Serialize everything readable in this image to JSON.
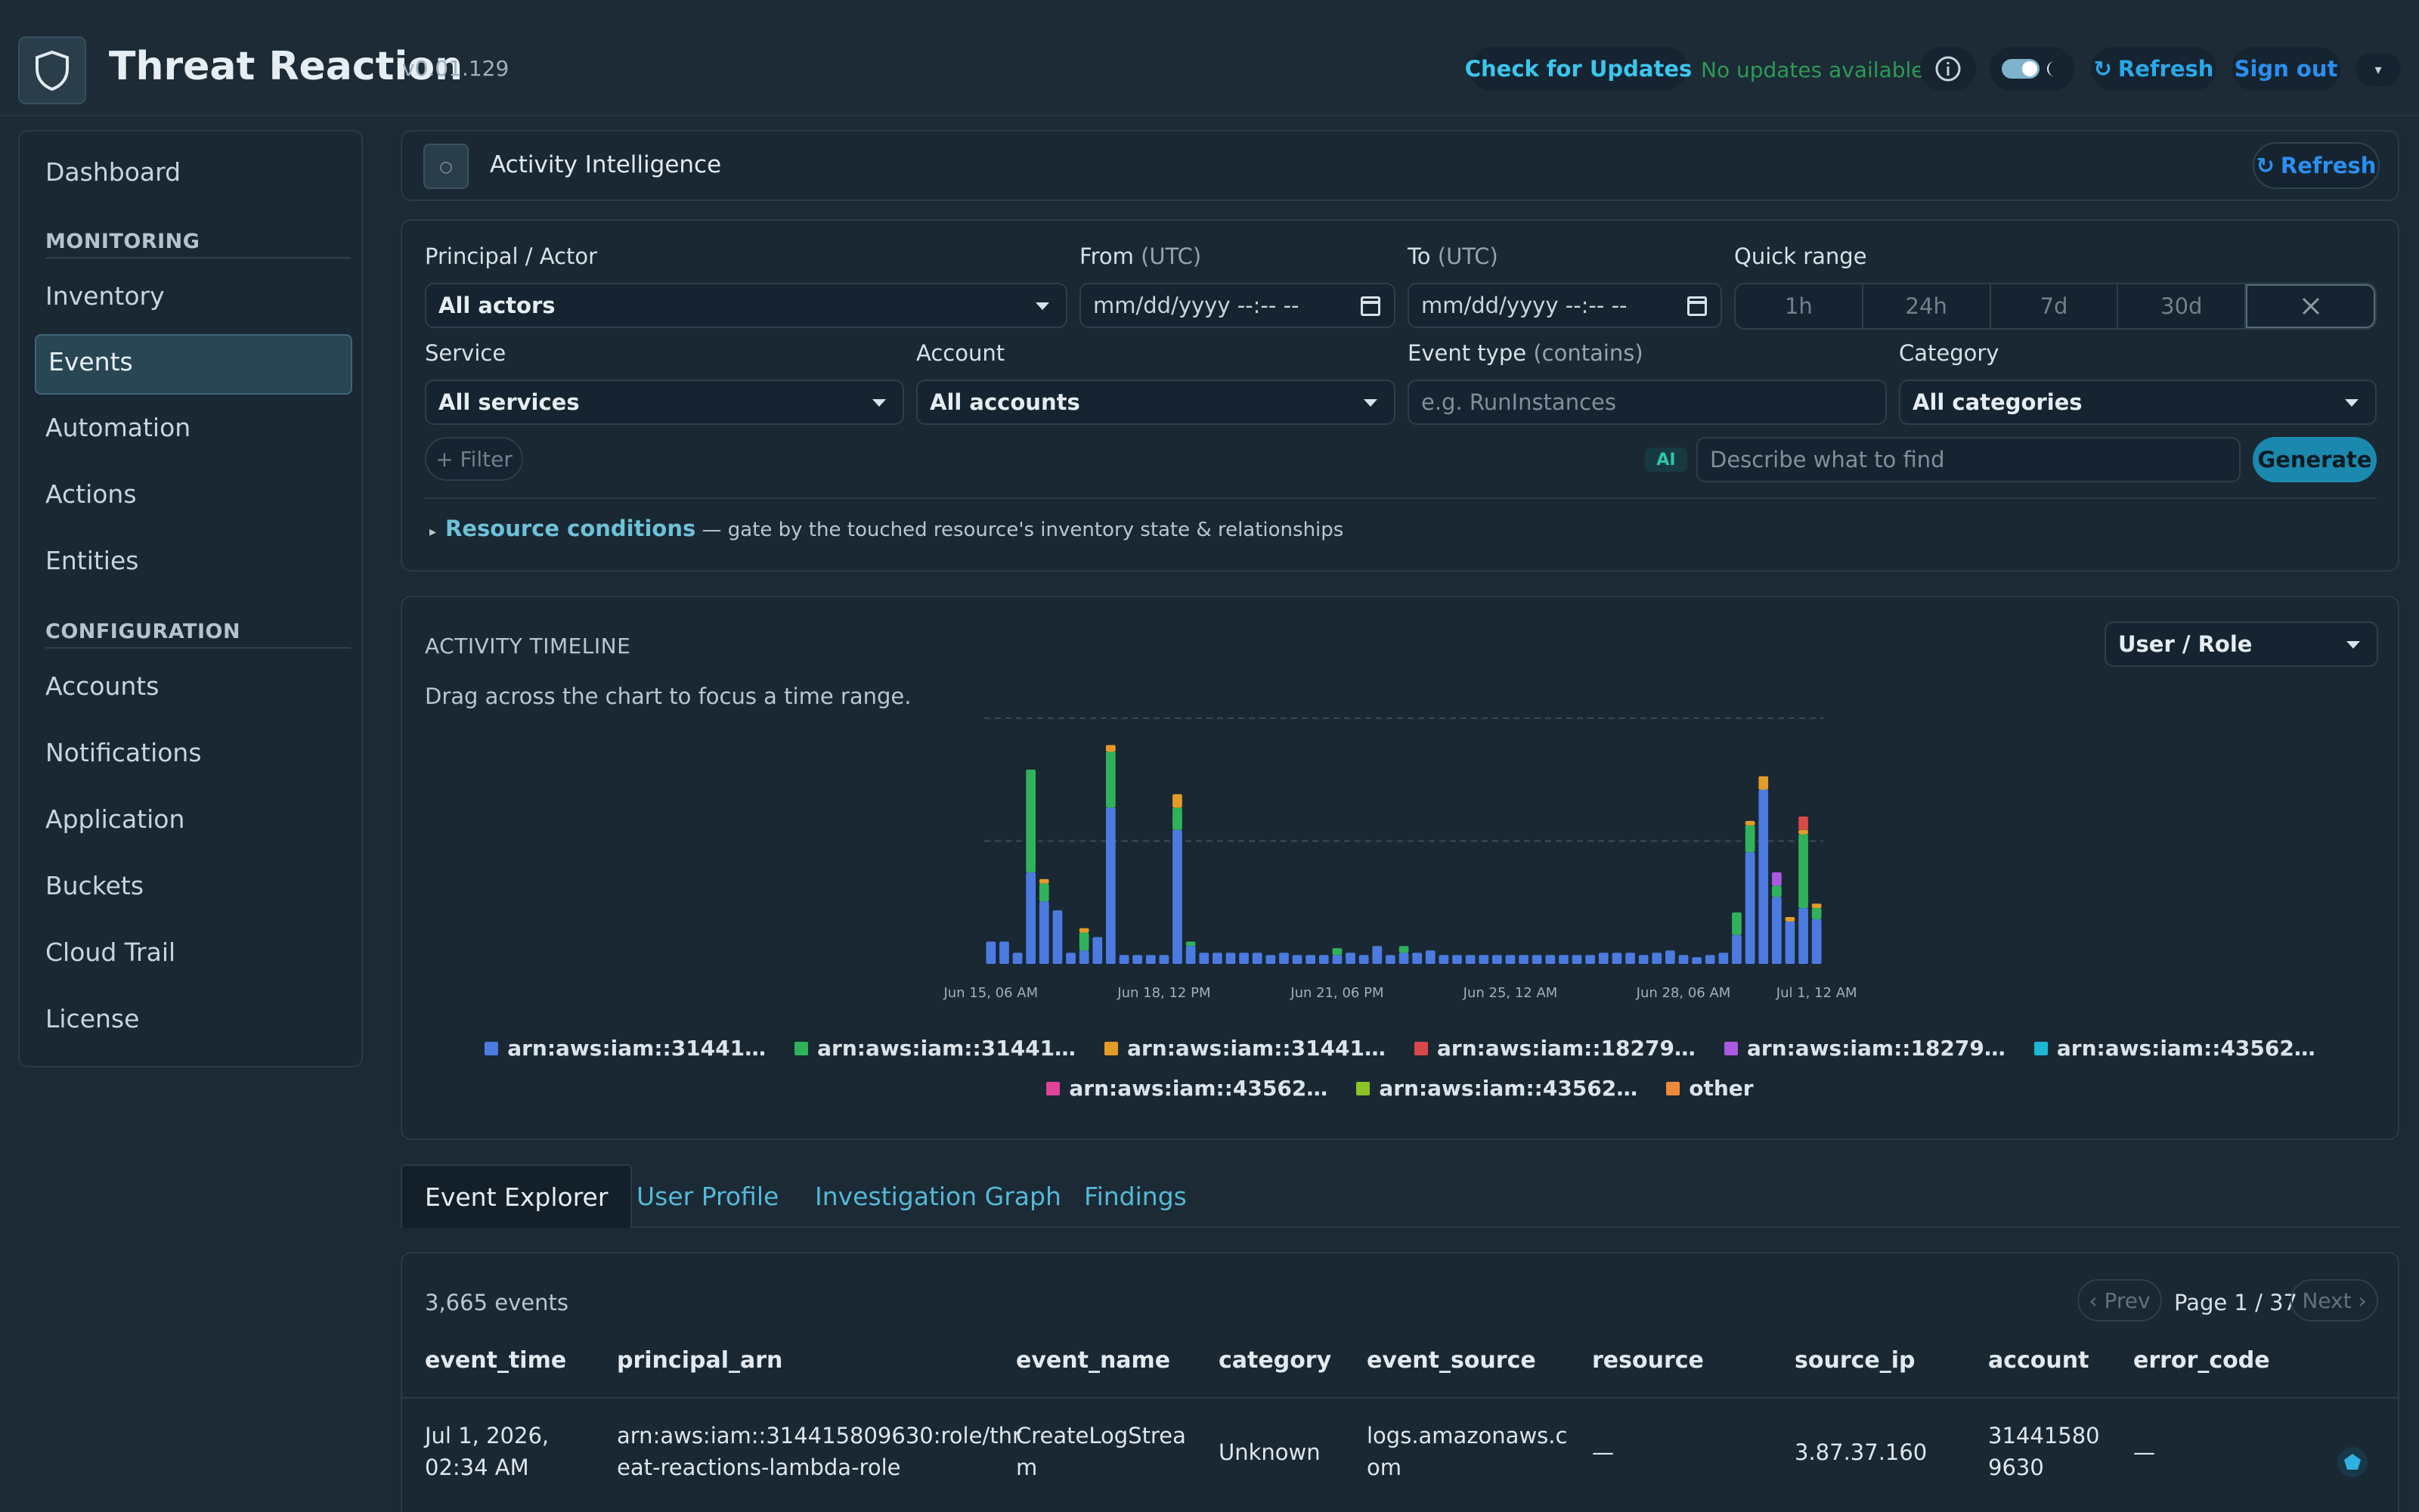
{
  "app": {
    "title": "Threat Reaction",
    "version": "v0.01.129",
    "check_updates": "Check for Updates",
    "update_status": "No updates available",
    "refresh": "Refresh",
    "sign_out": "Sign out"
  },
  "sidebar": {
    "items": [
      {
        "label": "Dashboard"
      },
      {
        "section": "MONITORING"
      },
      {
        "label": "Inventory"
      },
      {
        "label": "Events",
        "active": true
      },
      {
        "label": "Automation"
      },
      {
        "label": "Actions"
      },
      {
        "label": "Entities"
      },
      {
        "section": "CONFIGURATION"
      },
      {
        "label": "Accounts"
      },
      {
        "label": "Notifications"
      },
      {
        "label": "Application"
      },
      {
        "label": "Buckets"
      },
      {
        "label": "Cloud Trail"
      },
      {
        "label": "License"
      }
    ]
  },
  "activity": {
    "title": "Activity Intelligence",
    "refresh": "Refresh"
  },
  "filters": {
    "principal_label": "Principal / Actor",
    "principal_value": "All actors",
    "from_label": "From",
    "from_suffix": "(UTC)",
    "from_placeholder": "mm/dd/yyyy --:-- --",
    "to_label": "To",
    "to_suffix": "(UTC)",
    "to_placeholder": "mm/dd/yyyy --:-- --",
    "quick_range_label": "Quick range",
    "quick_ranges": [
      "1h",
      "24h",
      "7d",
      "30d"
    ],
    "service_label": "Service",
    "service_value": "All services",
    "account_label": "Account",
    "account_value": "All accounts",
    "event_type_label": "Event type",
    "event_type_suffix": "(contains)",
    "event_type_placeholder": "e.g. RunInstances",
    "category_label": "Category",
    "category_value": "All categories",
    "add_filter": "+ Filter",
    "ai_badge": "AI",
    "ai_placeholder": "Describe what to find",
    "generate": "Generate",
    "resource_conditions": "Resource conditions",
    "resource_conditions_desc": "— gate by the touched resource's inventory state & relationships"
  },
  "timeline": {
    "title": "ACTIVITY TIMELINE",
    "subtitle": "Drag across the chart to focus a time range.",
    "group_by": "User / Role"
  },
  "chart_data": {
    "type": "bar",
    "stacked": true,
    "x_tick_labels": [
      "Jun 15, 06 AM",
      "Jun 18, 12 PM",
      "Jun 21, 06 PM",
      "Jun 25, 12 AM",
      "Jun 28, 06 AM",
      "Jul 1, 12 AM"
    ],
    "x_tick_bar_index": [
      0,
      13,
      26,
      39,
      52,
      62
    ],
    "gridlines": [
      0.5,
      1.0
    ],
    "grid": "dashed horizontal",
    "legend_position": "bottom",
    "series": [
      {
        "name": "arn:aws:iam::31441…",
        "color": "#4b7be0",
        "values": [
          10,
          10,
          5,
          41,
          28,
          24,
          5,
          6,
          12,
          70,
          4,
          4,
          4,
          4,
          60,
          8,
          5,
          5,
          5,
          5,
          5,
          4,
          5,
          4,
          4,
          4,
          4,
          5,
          4,
          8,
          4,
          5,
          5,
          6,
          4,
          4,
          4,
          4,
          4,
          4,
          4,
          4,
          4,
          4,
          4,
          4,
          5,
          5,
          5,
          4,
          5,
          6,
          4,
          3,
          4,
          5,
          13,
          50,
          78,
          30,
          19,
          25,
          20
        ]
      },
      {
        "name": "arn:aws:iam::31441…",
        "color": "#2fb25b",
        "values": [
          0,
          0,
          0,
          46,
          8,
          0,
          0,
          8,
          0,
          25,
          0,
          0,
          0,
          0,
          10,
          2,
          0,
          0,
          0,
          0,
          0,
          0,
          0,
          0,
          0,
          0,
          3,
          0,
          0,
          0,
          0,
          3,
          0,
          0,
          0,
          0,
          0,
          0,
          0,
          0,
          0,
          0,
          0,
          0,
          0,
          0,
          0,
          0,
          0,
          0,
          0,
          0,
          0,
          0,
          0,
          0,
          10,
          12,
          0,
          5,
          0,
          33,
          5
        ]
      },
      {
        "name": "arn:aws:iam::31441…",
        "color": "#e39b28",
        "values": [
          0,
          0,
          0,
          0,
          2,
          0,
          0,
          2,
          0,
          3,
          0,
          0,
          0,
          0,
          6,
          0,
          0,
          0,
          0,
          0,
          0,
          0,
          0,
          0,
          0,
          0,
          0,
          0,
          0,
          0,
          0,
          0,
          0,
          0,
          0,
          0,
          0,
          0,
          0,
          0,
          0,
          0,
          0,
          0,
          0,
          0,
          0,
          0,
          0,
          0,
          0,
          0,
          0,
          0,
          0,
          0,
          0,
          2,
          6,
          0,
          2,
          2,
          2
        ]
      },
      {
        "name": "arn:aws:iam::18279…",
        "color": "#d94848",
        "values": [
          0,
          0,
          0,
          0,
          0,
          0,
          0,
          0,
          0,
          0,
          0,
          0,
          0,
          0,
          0,
          0,
          0,
          0,
          0,
          0,
          0,
          0,
          0,
          0,
          0,
          0,
          0,
          0,
          0,
          0,
          0,
          0,
          0,
          0,
          0,
          0,
          0,
          0,
          0,
          0,
          0,
          0,
          0,
          0,
          0,
          0,
          0,
          0,
          0,
          0,
          0,
          0,
          0,
          0,
          0,
          0,
          0,
          0,
          0,
          0,
          0,
          6,
          0
        ]
      },
      {
        "name": "arn:aws:iam::18279…",
        "color": "#a95ae0",
        "values": [
          0,
          0,
          0,
          0,
          0,
          0,
          0,
          0,
          0,
          0,
          0,
          0,
          0,
          0,
          0,
          0,
          0,
          0,
          0,
          0,
          0,
          0,
          0,
          0,
          0,
          0,
          0,
          0,
          0,
          0,
          0,
          0,
          0,
          0,
          0,
          0,
          0,
          0,
          0,
          0,
          0,
          0,
          0,
          0,
          0,
          0,
          0,
          0,
          0,
          0,
          0,
          0,
          0,
          0,
          0,
          0,
          0,
          0,
          0,
          6,
          0,
          0,
          0
        ]
      },
      {
        "name": "arn:aws:iam::43562…",
        "color": "#1db6d2",
        "values": [
          0,
          0,
          0,
          0,
          0,
          0,
          0,
          0,
          0,
          0,
          0,
          0,
          0,
          0,
          0,
          0,
          0,
          0,
          0,
          0,
          0,
          0,
          0,
          0,
          0,
          0,
          0,
          0,
          0,
          0,
          0,
          0,
          0,
          0,
          0,
          0,
          0,
          0,
          0,
          0,
          0,
          0,
          0,
          0,
          0,
          0,
          0,
          0,
          0,
          0,
          0,
          0,
          0,
          0,
          0,
          0,
          0,
          0,
          0,
          0,
          0,
          0,
          0
        ]
      },
      {
        "name": "arn:aws:iam::43562…",
        "color": "#e0449a",
        "values": [
          0,
          0,
          0,
          0,
          0,
          0,
          0,
          0,
          0,
          0,
          0,
          0,
          0,
          0,
          0,
          0,
          0,
          0,
          0,
          0,
          0,
          0,
          0,
          0,
          0,
          0,
          0,
          0,
          0,
          0,
          0,
          0,
          0,
          0,
          0,
          0,
          0,
          0,
          0,
          0,
          0,
          0,
          0,
          0,
          0,
          0,
          0,
          0,
          0,
          0,
          0,
          0,
          0,
          0,
          0,
          0,
          0,
          0,
          0,
          0,
          0,
          0,
          0
        ]
      },
      {
        "name": "arn:aws:iam::43562…",
        "color": "#8bc426",
        "values": [
          0,
          0,
          0,
          0,
          0,
          0,
          0,
          0,
          0,
          0,
          0,
          0,
          0,
          0,
          0,
          0,
          0,
          0,
          0,
          0,
          0,
          0,
          0,
          0,
          0,
          0,
          0,
          0,
          0,
          0,
          0,
          0,
          0,
          0,
          0,
          0,
          0,
          0,
          0,
          0,
          0,
          0,
          0,
          0,
          0,
          0,
          0,
          0,
          0,
          0,
          0,
          0,
          0,
          0,
          0,
          0,
          0,
          0,
          0,
          0,
          0,
          0,
          0
        ]
      },
      {
        "name": "other",
        "color": "#f08a38",
        "values": [
          0,
          0,
          0,
          0,
          0,
          0,
          0,
          0,
          0,
          0,
          0,
          0,
          0,
          0,
          0,
          0,
          0,
          0,
          0,
          0,
          0,
          0,
          0,
          0,
          0,
          0,
          0,
          0,
          0,
          0,
          0,
          0,
          0,
          0,
          0,
          0,
          0,
          0,
          0,
          0,
          0,
          0,
          0,
          0,
          0,
          0,
          0,
          0,
          0,
          0,
          0,
          0,
          0,
          0,
          0,
          0,
          0,
          0,
          0,
          0,
          0,
          0,
          0
        ]
      }
    ],
    "ylim": [
      0,
      110
    ]
  },
  "tabs": [
    "Event Explorer",
    "User Profile",
    "Investigation Graph",
    "Findings"
  ],
  "table": {
    "count": "3,665 events",
    "prev": "‹ Prev",
    "page": "Page 1 / 37",
    "next": "Next ›",
    "columns": [
      "event_time",
      "principal_arn",
      "event_name",
      "category",
      "event_source",
      "resource",
      "source_ip",
      "account",
      "error_code"
    ],
    "rows": [
      {
        "event_time": [
          "Jul 1, 2026,",
          "02:34 AM"
        ],
        "principal_arn": [
          "arn:aws:iam::314415809630:role/thr",
          "eat-reactions-lambda-role"
        ],
        "event_name": [
          "CreateLogStrea",
          "m"
        ],
        "category": [
          "Unknown"
        ],
        "event_source": [
          "logs.amazonaws.c",
          "om"
        ],
        "resource": [
          "—"
        ],
        "source_ip": [
          "3.87.37.160"
        ],
        "account": [
          "31441580",
          "9630"
        ],
        "error_code": [
          "—"
        ]
      }
    ]
  }
}
